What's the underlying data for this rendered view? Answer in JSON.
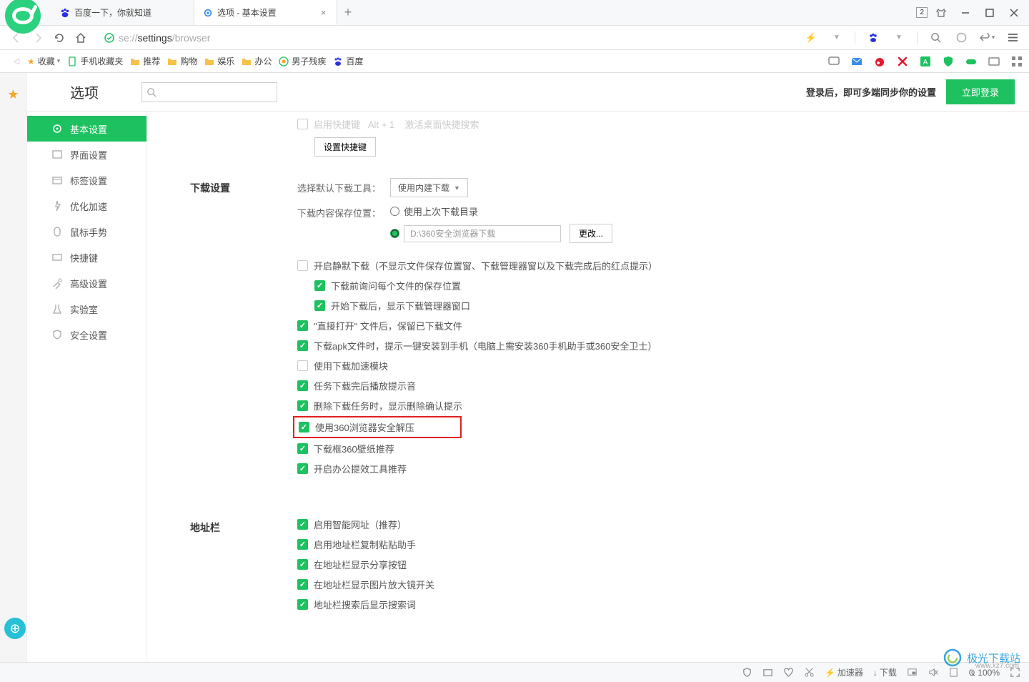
{
  "titlebar": {
    "tabs": [
      {
        "title": "百度一下，你就知道",
        "icon": "baidu",
        "active": false
      },
      {
        "title": "选项 - 基本设置",
        "icon": "gear",
        "active": true
      }
    ],
    "window_badge": "2"
  },
  "navbar": {
    "address_pre": "se://",
    "address_main": "settings",
    "address_post": "/browser"
  },
  "bookmarks": {
    "fav_label": "收藏",
    "items": [
      {
        "label": "手机收藏夹",
        "icon": "phone"
      },
      {
        "label": "推荐",
        "icon": "folder"
      },
      {
        "label": "购物",
        "icon": "folder"
      },
      {
        "label": "娱乐",
        "icon": "folder"
      },
      {
        "label": "办公",
        "icon": "folder"
      },
      {
        "label": "男子残疾",
        "icon": "360"
      },
      {
        "label": "百度",
        "icon": "baidu"
      }
    ]
  },
  "page": {
    "title": "选项",
    "login_msg": "登录后，即可多端同步你的设置",
    "login_btn": "立即登录"
  },
  "sidebar": {
    "items": [
      {
        "label": "基本设置",
        "active": true
      },
      {
        "label": "界面设置",
        "active": false
      },
      {
        "label": "标签设置",
        "active": false
      },
      {
        "label": "优化加速",
        "active": false
      },
      {
        "label": "鼠标手势",
        "active": false
      },
      {
        "label": "快捷键",
        "active": false
      },
      {
        "label": "高级设置",
        "active": false
      },
      {
        "label": "实验室",
        "active": false
      },
      {
        "label": "安全设置",
        "active": false
      }
    ]
  },
  "sec_top": {
    "shortcut_btn": "设置快捷键"
  },
  "sec_download": {
    "title": "下载设置",
    "tool_label": "选择默认下载工具：",
    "tool_value": "使用内建下载",
    "path_label": "下载内容保存位置：",
    "radio_last": "使用上次下载目录",
    "path_value": "D:\\360安全浏览器下载",
    "change_btn": "更改...",
    "opt_silent": "开启静默下载（不显示文件保存位置窗、下载管理器窗以及下载完成后的红点提示）",
    "opt_ask": "下载前询问每个文件的保存位置",
    "opt_show_mgr": "开始下载后，显示下载管理器窗口",
    "opt_direct_open": "\"直接打开\" 文件后，保留已下载文件",
    "opt_apk": "下载apk文件时，提示一键安装到手机（电脑上需安装360手机助手或360安全卫士）",
    "opt_accel": "使用下载加速模块",
    "opt_sound": "任务下载完后播放提示音",
    "opt_del_confirm": "删除下载任务时，显示删除确认提示",
    "opt_unzip": "使用360浏览器安全解压",
    "opt_wallpaper": "下载框360壁纸推荐",
    "opt_office": "开启办公提效工具推荐"
  },
  "sec_addr": {
    "title": "地址栏",
    "opt_smart": "启用智能网址（推荐）",
    "opt_paste": "启用地址栏复制粘贴助手",
    "opt_share": "在地址栏显示分享按钮",
    "opt_mag": "在地址栏显示图片放大镜开关",
    "opt_search": "地址栏搜索后显示搜索词"
  },
  "statusbar": {
    "accel": "加速器",
    "download": "下载",
    "zoom": "100%"
  },
  "watermark": {
    "text": "极光下载站",
    "url": "www.xz7.com"
  }
}
